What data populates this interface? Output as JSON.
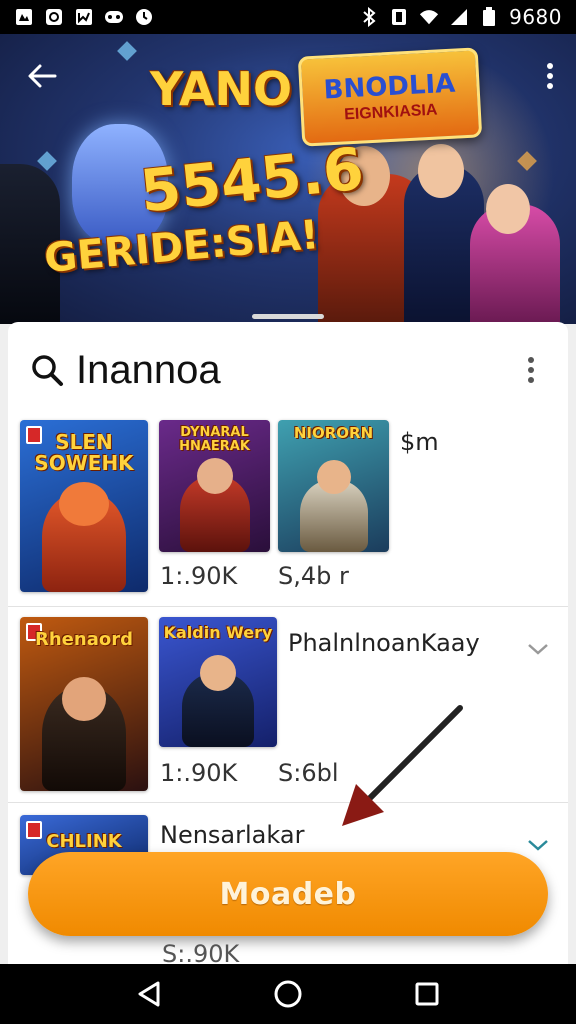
{
  "status_bar": {
    "time": "9680",
    "left_icons": [
      "notification-icon",
      "sync-icon",
      "gallery-icon",
      "game-icon",
      "alarm-icon"
    ],
    "right_icons": [
      "bluetooth-icon",
      "vibrate-icon",
      "wifi-icon",
      "signal-icon",
      "battery-icon"
    ]
  },
  "hero": {
    "title_top": "YANO",
    "title_big": "5545.6",
    "title_bottom": "GERIDE:SIA!",
    "badge_line1": "BNODLIA",
    "badge_line2": "EIGNKIASIA",
    "back_icon": "arrow-left-icon",
    "more_icon": "more-vertical-icon"
  },
  "search": {
    "query": "Inannoa",
    "icon": "search-icon",
    "more_icon": "more-vertical-icon"
  },
  "rows": [
    {
      "covers": [
        {
          "title": "SLEN SOWEHK"
        },
        {
          "title": "DYNARAL HNAERAK"
        },
        {
          "title": "NIORORN"
        }
      ],
      "prices": [
        "1:.90K",
        "S,4b r"
      ],
      "side_label": "$m"
    },
    {
      "covers": [
        {
          "title": "Rhenaord"
        },
        {
          "title": "Kaldin Wery"
        }
      ],
      "prices": [
        "1:.90K",
        "S:6bl"
      ],
      "title": "PhalnlnoanKaay",
      "chevron_icon": "chevron-down-icon"
    },
    {
      "covers": [
        {
          "title": "CHLINK"
        }
      ],
      "title": "Nensarlakar",
      "chevron_icon": "chevron-down-icon",
      "price": "S:.90K"
    }
  ],
  "cta": {
    "label": "Moadeb"
  },
  "colors": {
    "cta": "#f59300",
    "hero_bg": "#22356e",
    "title_gold": "#ffd23c"
  },
  "nav_bar": {
    "icons": [
      "back-triangle-icon",
      "home-circle-icon",
      "recents-square-icon"
    ]
  }
}
